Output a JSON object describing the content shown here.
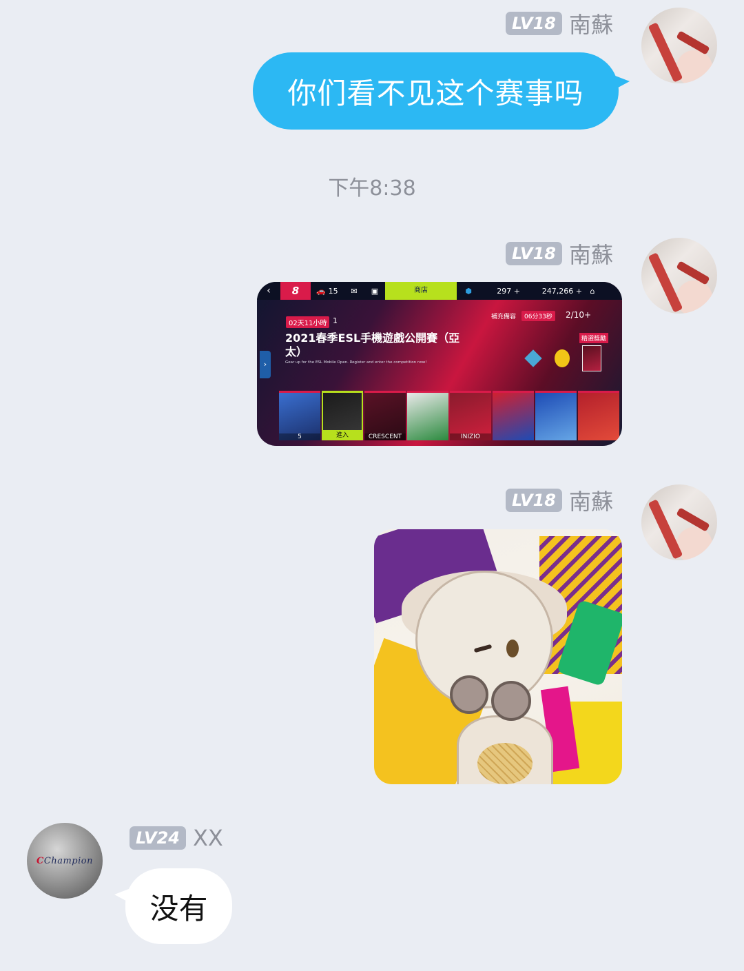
{
  "messages": [
    {
      "sender": {
        "level": "LV18",
        "name": "南蘇"
      },
      "text": "你们看不见这个赛事吗"
    },
    {
      "timestamp": "下午8:38"
    },
    {
      "sender": {
        "level": "LV18",
        "name": "南蘇"
      },
      "image": {
        "topbar": {
          "back": "‹",
          "level": "8",
          "cars": "15",
          "shop": "商店",
          "tokens": "297 +",
          "credits": "247,266 +"
        },
        "timer": "02天11小時",
        "count": "1",
        "title": "2021春季ESL手機遊戲公開賽（亞太）",
        "subtitle": "Gear up for the ESL Mobile Open. Register and enter the competition now!",
        "right_label": "補充備容",
        "right_timer": "06分33秒",
        "right_count": "2/10+",
        "reward_label": "精選獎勵",
        "side_arrow": "›",
        "cards": [
          {
            "label": "5"
          },
          {
            "label": "進入"
          },
          {
            "label": "CRESCENT"
          },
          {
            "label": ""
          },
          {
            "label": "INIZIO"
          },
          {
            "label": ""
          },
          {
            "label": ""
          },
          {
            "label": ""
          }
        ]
      }
    },
    {
      "sender": {
        "level": "LV18",
        "name": "南蘇"
      },
      "sticker": "anime-girl-sticker"
    },
    {
      "sender": {
        "level": "LV24",
        "name": "XX"
      },
      "text": "没有"
    }
  ],
  "other_avatar_logo": "Champion",
  "colors": {
    "background": "#eaedf3",
    "own_bubble": "#2cb8f3",
    "other_bubble": "#ffffff",
    "level_badge": "#b3b9c6",
    "name_text": "#8d9099"
  }
}
